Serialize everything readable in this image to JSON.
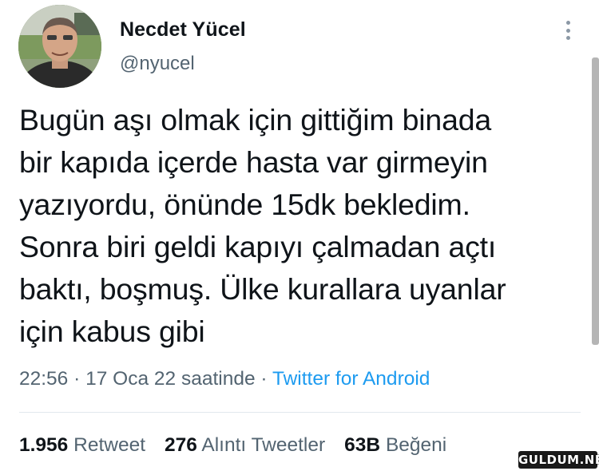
{
  "author": {
    "display_name": "Necdet Yücel",
    "handle": "@nyucel"
  },
  "tweet": {
    "lines": [
      "Bugün aşı olmak için gittiğim binada",
      "bir kapıda içerde hasta var girmeyin",
      "yazıyordu, önünde 15dk bekledim.",
      "Sonra biri geldi kapıyı çalmadan açtı",
      "baktı, boşmuş. Ülke kurallara uyanlar",
      "için kabus gibi"
    ],
    "time": "22:56",
    "date": "17 Oca 22 saatinde",
    "separator": "·",
    "source": "Twitter for Android"
  },
  "stats": {
    "retweets_count": "1.956",
    "retweets_label": "Retweet",
    "quotes_count": "276",
    "quotes_label": "Alıntı Tweetler",
    "likes_count": "63B",
    "likes_label": "Beğeni"
  },
  "icons": {
    "more": "more-vertical-icon"
  },
  "colors": {
    "text_primary": "#0f1419",
    "text_secondary": "#536471",
    "link": "#1d9bf0"
  },
  "watermark": "GULDUM.NET"
}
